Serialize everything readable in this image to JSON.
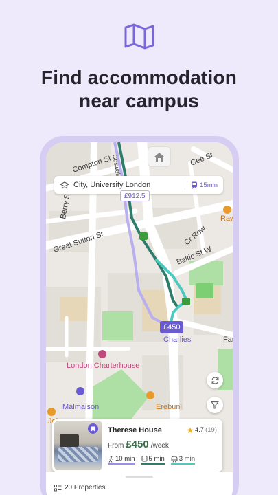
{
  "hero": {
    "icon": "map-icon",
    "headline_line1": "Find accommodation",
    "headline_line2": "near campus"
  },
  "map": {
    "streets": [
      "Goswell Rd",
      "Gee St",
      "Compton St",
      "Berry St",
      "Great Sutton St",
      "Cr Row",
      "Baltic St W",
      "Fann"
    ],
    "places": [
      "Charlies",
      "London Charterhouse",
      "Malmaison",
      "Erebuni",
      "John",
      "Raw"
    ],
    "home_button_icon": "home-icon"
  },
  "search": {
    "location": "City, University London",
    "travel_time": "15min"
  },
  "price_markers": [
    "£912.5",
    "£450"
  ],
  "controls": {
    "refresh_icon": "refresh-icon",
    "filter_icon": "filter-icon"
  },
  "property_card": {
    "name": "Therese House",
    "rating": "4.7",
    "reviews": "(19)",
    "price_prefix": "From",
    "price": "£450",
    "price_unit": "/week",
    "walk_time": "10 min",
    "bus_time": "5 min",
    "train_time": "3 min"
  },
  "sheet": {
    "properties_count": "20 Properties"
  },
  "colors": {
    "background": "#eeeafc",
    "accent": "#6a5bd0",
    "route_dark": "#2e7d6b",
    "route_light": "#4dc9c0",
    "price_green": "#3c6e4a"
  }
}
